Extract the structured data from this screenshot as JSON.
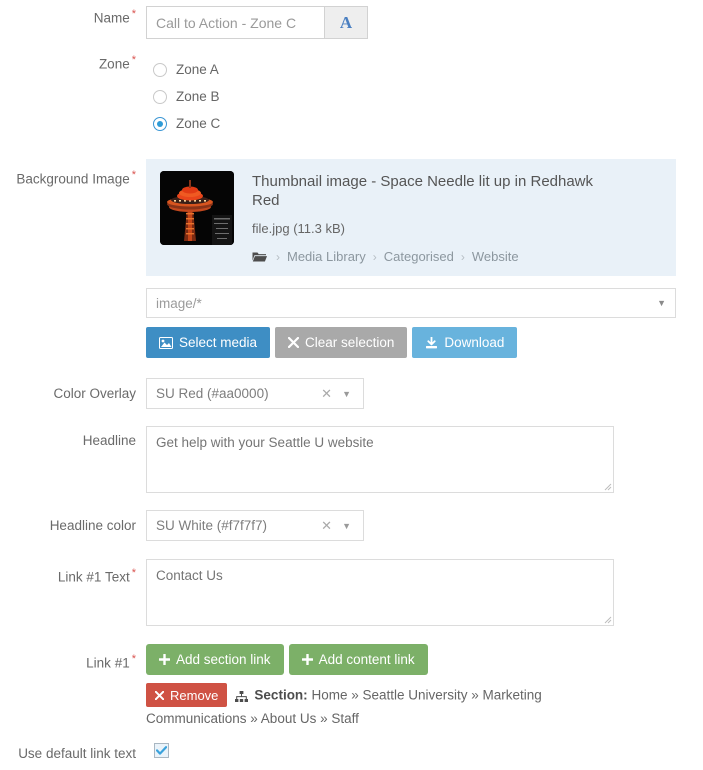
{
  "form": {
    "required_marker": "*",
    "fields": {
      "name": {
        "label": "Name",
        "placeholder": "Call to Action - Zone C",
        "value": "",
        "addon_label": "A"
      },
      "zone": {
        "label": "Zone",
        "options": [
          {
            "label": "Zone A",
            "checked": false
          },
          {
            "label": "Zone B",
            "checked": false
          },
          {
            "label": "Zone C",
            "checked": true
          }
        ]
      },
      "background_image": {
        "label": "Background Image",
        "media_title": "Thumbnail image - Space Needle lit up in Redhawk Red",
        "file_name": "file.jpg (11.3 kB)",
        "breadcrumb": [
          "Media Library",
          "Categorised",
          "Website"
        ],
        "breadcrumb_separator": "›",
        "mime_filter": "image/*",
        "buttons": {
          "select_media": "Select media",
          "clear_selection": "Clear selection",
          "download": "Download"
        }
      },
      "color_overlay": {
        "label": "Color Overlay",
        "value": "SU Red (#aa0000)",
        "clear_glyph": "✕",
        "arrow_glyph": "▼"
      },
      "headline": {
        "label": "Headline",
        "placeholder": "Get help with your Seattle U website",
        "value": ""
      },
      "headline_color": {
        "label": "Headline color",
        "value": "SU White (#f7f7f7)",
        "clear_glyph": "✕",
        "arrow_glyph": "▼"
      },
      "link1_text": {
        "label": "Link #1 Text",
        "placeholder": "Contact Us",
        "value": ""
      },
      "link1": {
        "label": "Link #1",
        "add_section_link": "Add section link",
        "add_content_link": "Add content link",
        "remove": "Remove",
        "section_label": "Section:",
        "section_path": "Home » Seattle University » Marketing Communications » About Us » Staff"
      },
      "use_default_link_text": {
        "label": "Use default link text",
        "checked": true
      }
    }
  },
  "colors": {
    "panel_background": "#e9f1f8",
    "primary_button": "#3e8ec4",
    "gray_button": "#a9a9a9",
    "info_button": "#68b3dd",
    "green_button": "#7cb068",
    "danger_button": "#cf5244",
    "required_marker": "#d9534f",
    "radio_selected": "#2e9bd6"
  }
}
